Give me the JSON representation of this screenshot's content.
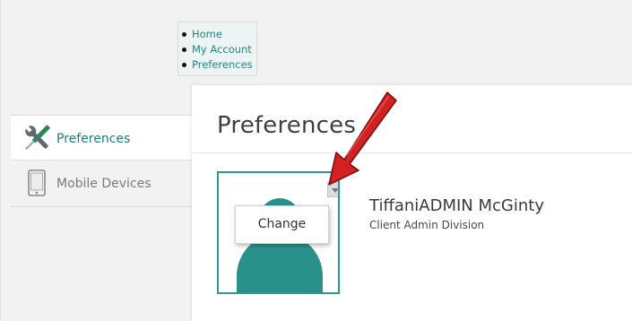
{
  "breadcrumb": {
    "items": [
      {
        "label": "Home"
      },
      {
        "label": "My Account"
      },
      {
        "label": "Preferences"
      }
    ]
  },
  "sidebar": {
    "items": [
      {
        "label": "Preferences",
        "icon": "tools-icon",
        "active": true
      },
      {
        "label": "Mobile Devices",
        "icon": "phone-icon",
        "active": false
      }
    ]
  },
  "main": {
    "title": "Preferences",
    "profile": {
      "name": "TiffaniADMIN McGinty",
      "organization": "Client Admin Division",
      "menu": {
        "change_label": "Change"
      }
    }
  },
  "annotation": {
    "type": "red-arrow",
    "target": "avatar-menu-caret"
  },
  "colors": {
    "accent": "#2a918a",
    "link": "#20877f",
    "arrow": "#d32020",
    "background": "#f2f2f2"
  }
}
